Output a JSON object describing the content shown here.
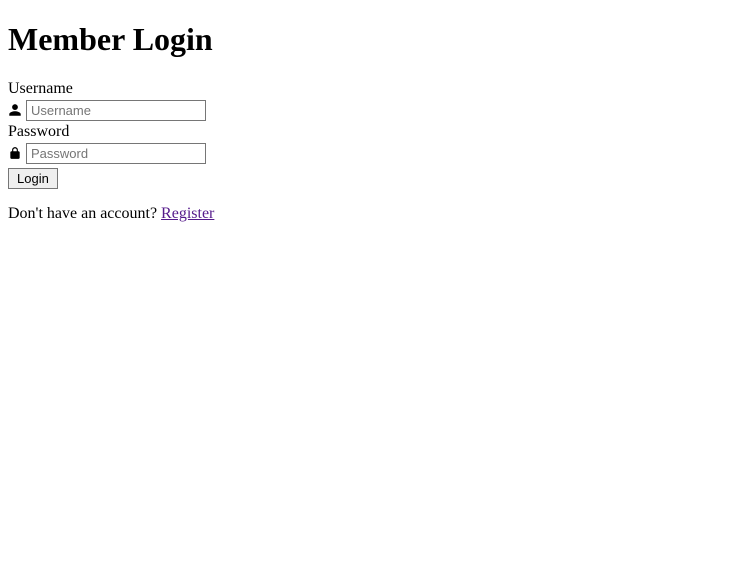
{
  "title": "Member Login",
  "form": {
    "username_label": "Username",
    "username_placeholder": "Username",
    "username_value": "",
    "password_label": "Password",
    "password_placeholder": "Password",
    "password_value": "",
    "login_button": "Login"
  },
  "register": {
    "prompt": "Don't have an account? ",
    "link_text": "Register"
  },
  "icons": {
    "user": "user-icon",
    "lock": "lock-icon"
  }
}
